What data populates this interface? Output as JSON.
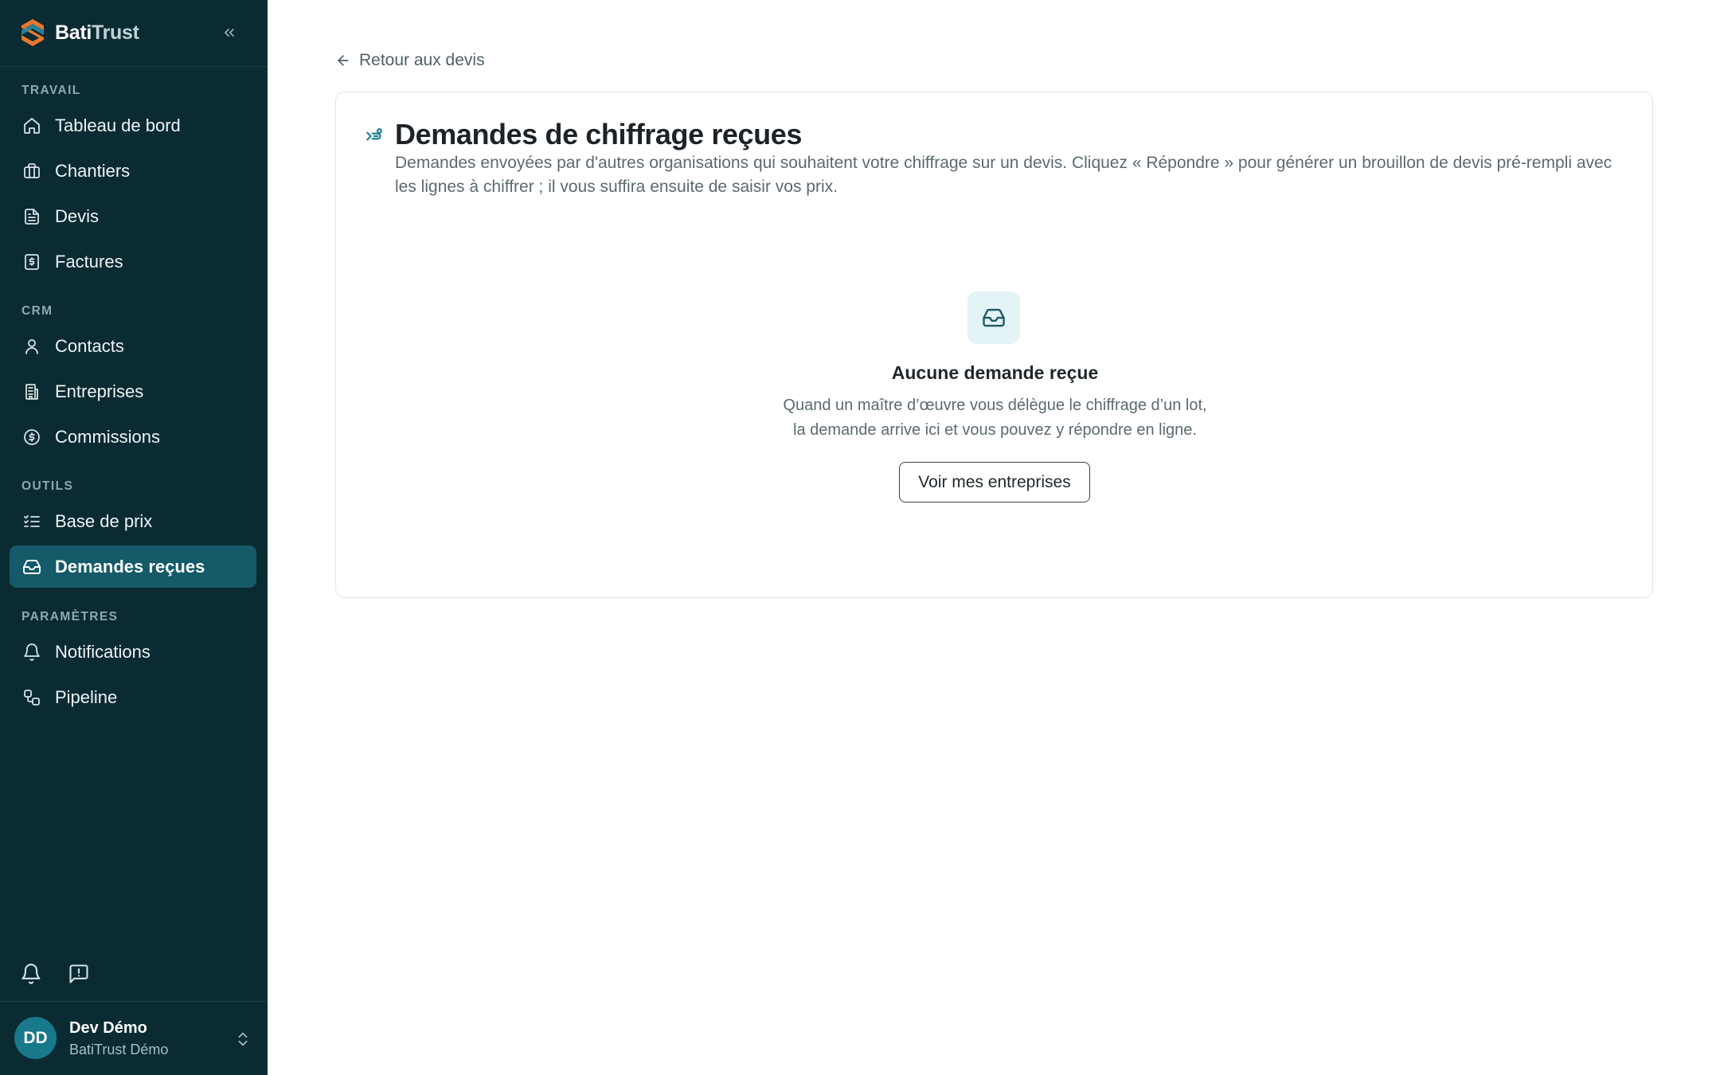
{
  "brand": {
    "name_part1": "Bati",
    "name_part2": "Trust",
    "colors": {
      "sidebar": "#0b2b33",
      "active": "#145a68",
      "accent": "#17798a",
      "logo_orange": "#e8762c"
    }
  },
  "sidebar": {
    "sections": [
      {
        "label": "TRAVAIL",
        "items": [
          {
            "label": "Tableau de bord",
            "icon": "home-icon"
          },
          {
            "label": "Chantiers",
            "icon": "briefcase-icon"
          },
          {
            "label": "Devis",
            "icon": "document-icon"
          },
          {
            "label": "Factures",
            "icon": "invoice-icon"
          }
        ]
      },
      {
        "label": "CRM",
        "items": [
          {
            "label": "Contacts",
            "icon": "user-icon"
          },
          {
            "label": "Entreprises",
            "icon": "building-icon"
          },
          {
            "label": "Commissions",
            "icon": "dollar-circle-icon"
          }
        ]
      },
      {
        "label": "OUTILS",
        "items": [
          {
            "label": "Base de prix",
            "icon": "list-check-icon"
          },
          {
            "label": "Demandes reçues",
            "icon": "inbox-icon",
            "active": true
          }
        ]
      },
      {
        "label": "PARAMÈTRES",
        "items": [
          {
            "label": "Notifications",
            "icon": "bell-icon"
          },
          {
            "label": "Pipeline",
            "icon": "workflow-icon"
          }
        ]
      }
    ],
    "footer_icons": [
      "bell-icon",
      "message-alert-icon"
    ],
    "user": {
      "initials": "DD",
      "name": "Dev Démo",
      "org": "BatiTrust Démo"
    }
  },
  "main": {
    "back_label": "Retour aux devis",
    "card": {
      "title": "Demandes de chiffrage reçues",
      "description": "Demandes envoyées par d'autres organisations qui souhaitent votre chiffrage sur un devis. Cliquez « Répondre » pour générer un brouillon de devis pré-rempli avec les lignes à chiffrer ; il vous suffira ensuite de saisir vos prix.",
      "empty": {
        "title": "Aucune demande reçue",
        "line1": "Quand un maître d’œuvre vous délègue le chiffrage d’un lot,",
        "line2": "la demande arrive ici et vous pouvez y répondre en ligne.",
        "button": "Voir mes entreprises"
      }
    }
  }
}
